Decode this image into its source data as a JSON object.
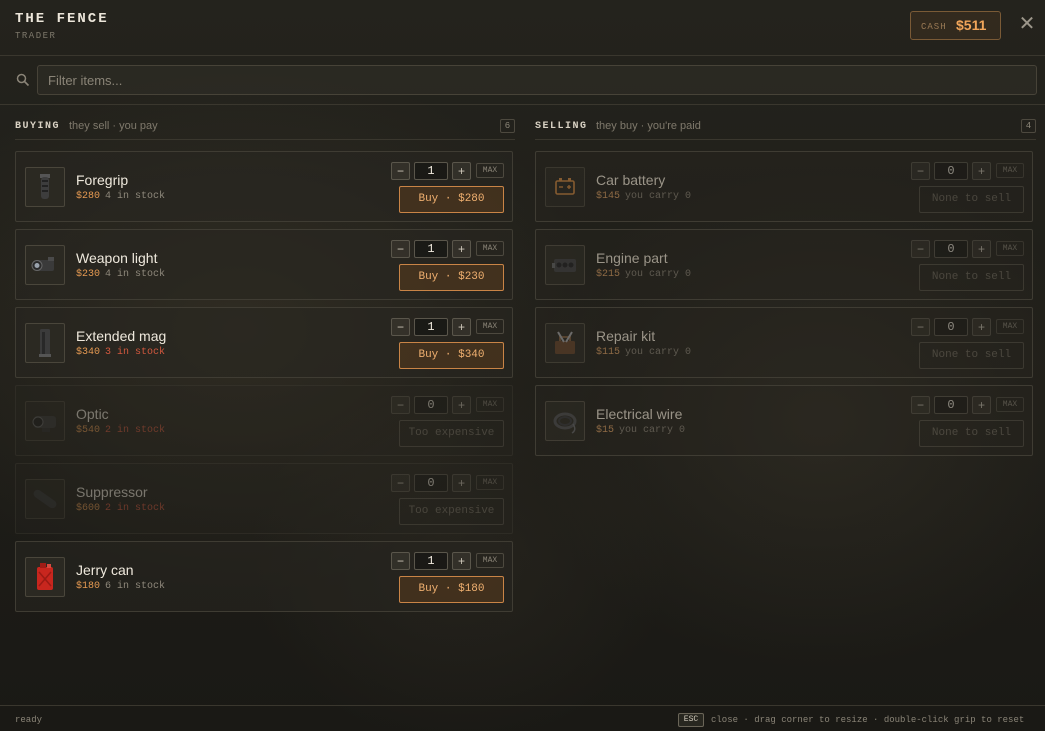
{
  "header": {
    "title": "THE FENCE",
    "subtitle": "TRADER",
    "cash_label": "CASH",
    "cash_value": "$511",
    "close_icon": "close-icon"
  },
  "search": {
    "placeholder": "Filter items...",
    "value": "",
    "icon": "search-icon"
  },
  "buying": {
    "title": "BUYING",
    "subtitle": "they sell · you pay",
    "count": "6",
    "items": [
      {
        "name": "Foregrip",
        "price": "$280",
        "stock": "4 in stock",
        "stock_low": false,
        "qty": "1",
        "action": "Buy · $280",
        "disabled": false,
        "icon": "foregrip-icon"
      },
      {
        "name": "Weapon light",
        "price": "$230",
        "stock": "4 in stock",
        "stock_low": false,
        "qty": "1",
        "action": "Buy · $230",
        "disabled": false,
        "icon": "flashlight-icon"
      },
      {
        "name": "Extended mag",
        "price": "$340",
        "stock": "3 in stock",
        "stock_low": true,
        "qty": "1",
        "action": "Buy · $340",
        "disabled": false,
        "icon": "magazine-icon"
      },
      {
        "name": "Optic",
        "price": "$540",
        "stock": "2 in stock",
        "stock_low": true,
        "qty": "0",
        "action": "Too expensive",
        "disabled": true,
        "icon": "optic-icon"
      },
      {
        "name": "Suppressor",
        "price": "$600",
        "stock": "2 in stock",
        "stock_low": true,
        "qty": "0",
        "action": "Too expensive",
        "disabled": true,
        "icon": "suppressor-icon"
      },
      {
        "name": "Jerry can",
        "price": "$180",
        "stock": "6 in stock",
        "stock_low": false,
        "qty": "1",
        "action": "Buy · $180",
        "disabled": false,
        "icon": "jerry-can-icon"
      }
    ]
  },
  "selling": {
    "title": "SELLING",
    "subtitle": "they buy · you're paid",
    "count": "4",
    "items": [
      {
        "name": "Car battery",
        "price": "$145",
        "carry": "you carry 0",
        "qty": "0",
        "action": "None to sell",
        "icon": "battery-icon"
      },
      {
        "name": "Engine part",
        "price": "$215",
        "carry": "you carry 0",
        "qty": "0",
        "action": "None to sell",
        "icon": "engine-icon"
      },
      {
        "name": "Repair kit",
        "price": "$115",
        "carry": "you carry 0",
        "qty": "0",
        "action": "None to sell",
        "icon": "toolbox-icon"
      },
      {
        "name": "Electrical wire",
        "price": "$15",
        "carry": "you carry 0",
        "qty": "0",
        "action": "None to sell",
        "icon": "wire-coil-icon"
      }
    ]
  },
  "controls": {
    "minus": "−",
    "plus": "+",
    "max": "MAX"
  },
  "footer": {
    "status": "ready",
    "key": "ESC",
    "hint": "close · drag corner to resize · double-click grip to reset"
  },
  "colors": {
    "accent": "#e69a52",
    "low_stock": "#d2583e",
    "cash": "#f0a55a"
  }
}
